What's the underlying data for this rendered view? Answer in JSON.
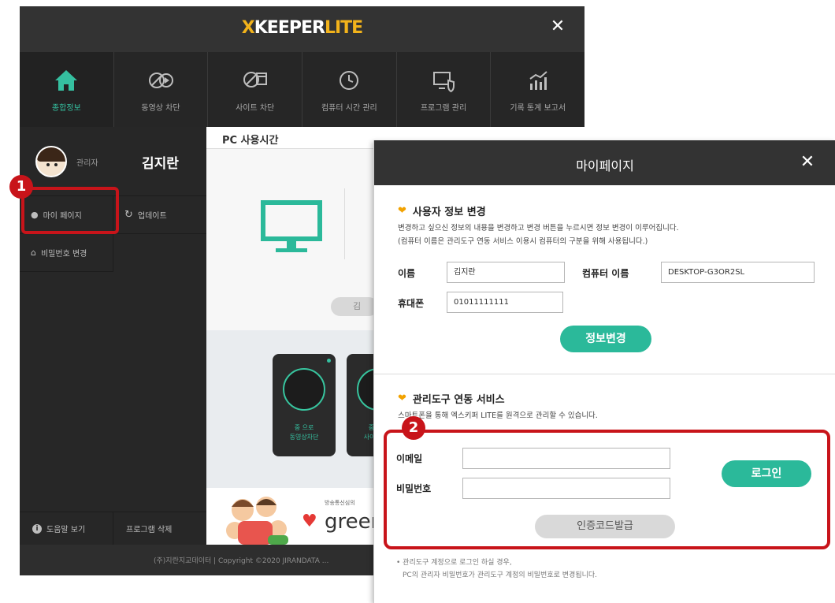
{
  "app": {
    "brand_x": "X",
    "brand_keeper": "KEEPER",
    "brand_lite": "LITE",
    "close_glyph": "✕"
  },
  "nav": [
    {
      "label": "종합정보",
      "icon": "home-icon"
    },
    {
      "label": "동영상 차단",
      "icon": "video-block-icon"
    },
    {
      "label": "사이트 차단",
      "icon": "site-block-icon"
    },
    {
      "label": "컴퓨터 시간 관리",
      "icon": "clock-icon"
    },
    {
      "label": "프로그램 관리",
      "icon": "program-shield-icon"
    },
    {
      "label": "기록 통계 보고서",
      "icon": "chart-icon"
    }
  ],
  "sidebar": {
    "role": "관리자",
    "user_name": "김지란",
    "my_page": "마이 페이지",
    "update": "업데이트",
    "change_password": "비밀번호 변경",
    "help": "도움말 보기",
    "uninstall": "프로그램 삭제"
  },
  "footer": {
    "text": "(주)지란지교데이터 | Copyright ©2020 JIRANDATA ..."
  },
  "content": {
    "header": "PC 사용시간",
    "pill_text": "김",
    "cards": [
      {
        "line1": "중 으로",
        "line2": "동영상차단"
      },
      {
        "line1": "중 으로",
        "line2": "사이트차단"
      }
    ],
    "banner_small": "방송통신심의",
    "banner_big": "greer"
  },
  "callouts": {
    "badge1": "1",
    "badge2": "2"
  },
  "dialog": {
    "title": "마이페이지",
    "close_glyph": "✕",
    "section1": {
      "title": "사용자 정보 변경",
      "desc1": "변경하고 싶으신 정보의 내용을 변경하고 변경 버튼을 누르시면 정보 변경이 이루어집니다.",
      "desc2": "(컴퓨터 이름은 관리도구 연동 서비스 이용시 컴퓨터의 구분을 위해 사용됩니다.)",
      "name_label": "이름",
      "name_value": "김지란",
      "computer_label": "컴퓨터 이름",
      "computer_value": "DESKTOP-G3OR2SL",
      "phone_label": "휴대폰",
      "phone_value": "01011111111",
      "change_button": "정보변경"
    },
    "section2": {
      "title": "관리도구 연동 서비스",
      "desc1": "스마트폰을 통해 엑스키퍼 LITE를 원격으로 관리할 수 있습니다.",
      "email_label": "이메일",
      "password_label": "비밀번호",
      "login_button": "로그인",
      "auth_button": "인증코드발급",
      "note1": "• 관리도구 계정으로 로그인 하실 경우,",
      "note2": "PC의 관리자 비밀번호가 관리도구 계정의 비밀번호로 변경됩니다."
    }
  },
  "colors": {
    "accent_green": "#2bb99a",
    "brand_yellow": "#f2b31b",
    "callout_red": "#c8141a",
    "dark_bg": "#2a2a2a"
  }
}
